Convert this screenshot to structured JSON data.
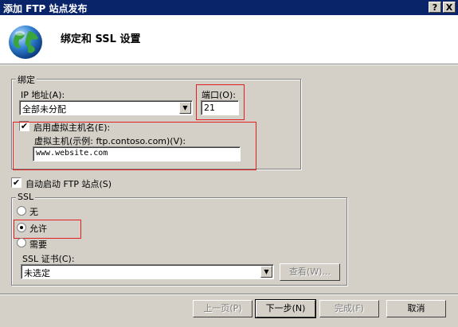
{
  "window": {
    "title": "添加 FTP 站点发布",
    "help_label": "?",
    "close_label": "X"
  },
  "header": {
    "title": "绑定和 SSL 设置"
  },
  "binding": {
    "group_label": "绑定",
    "ip_label": "IP 地址(A):",
    "ip_value": "全部未分配",
    "port_label": "端口(O):",
    "port_value": "21",
    "enable_vhost_label": "启用虚拟主机名(E):",
    "enable_vhost_checked": true,
    "vhost_label": "虚拟主机(示例: ftp.contoso.com)(V):",
    "vhost_value": "www.website.com"
  },
  "autostart": {
    "label": "自动启动 FTP 站点(S)",
    "checked": true
  },
  "ssl": {
    "group_label": "SSL",
    "options": [
      {
        "label": "无",
        "selected": false
      },
      {
        "label": "允许",
        "selected": true
      },
      {
        "label": "需要",
        "selected": false
      }
    ],
    "cert_label": "SSL 证书(C):",
    "cert_value": "未选定",
    "view_button": "查看(W)..."
  },
  "footer": {
    "prev": "上一页(P)",
    "next": "下一步(N)",
    "finish": "完成(F)",
    "cancel": "取消"
  },
  "icons": {
    "arrow": "▼",
    "check": "✔"
  }
}
